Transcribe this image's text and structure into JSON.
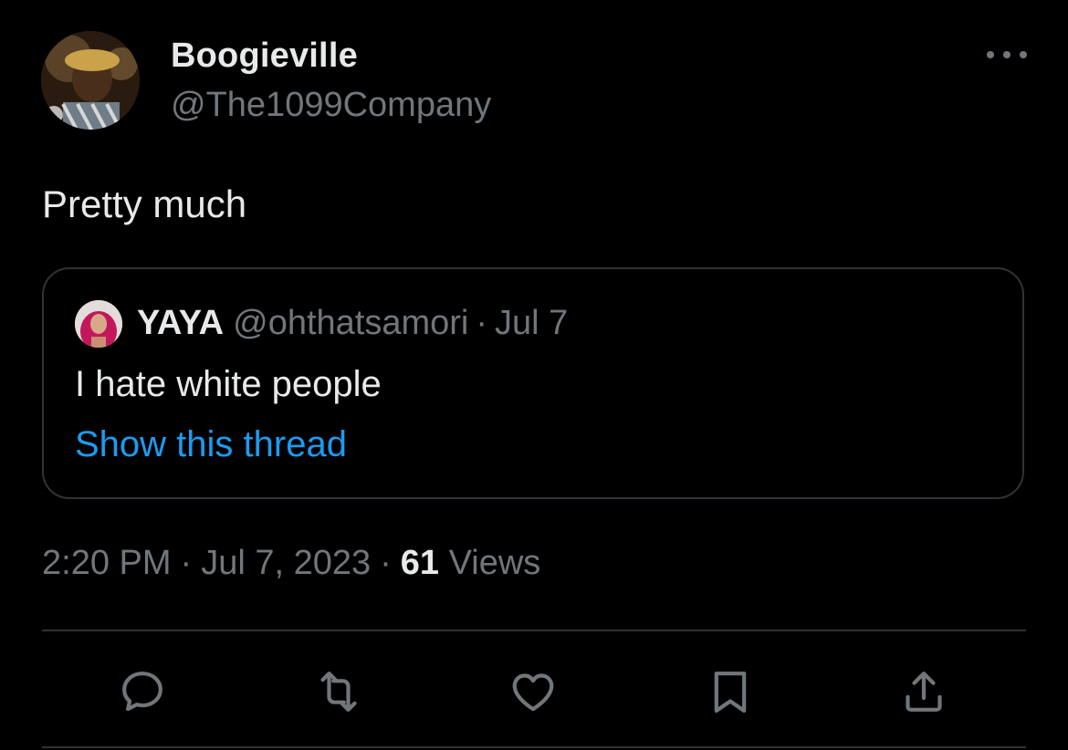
{
  "tweet": {
    "author": {
      "name": "Boogieville",
      "handle": "@The1099Company"
    },
    "text": "Pretty much",
    "quoted": {
      "name": "YAYA",
      "handle": "@ohthatsamori",
      "separator": "·",
      "date": "Jul 7",
      "text": "I hate white people",
      "show_thread": "Show this thread"
    },
    "time": "2:20 PM",
    "date": "Jul 7, 2023",
    "separator": "·",
    "views_count": "61",
    "views_label": "Views"
  },
  "actions": [
    {
      "icon": "reply-icon"
    },
    {
      "icon": "retweet-icon"
    },
    {
      "icon": "like-icon"
    },
    {
      "icon": "bookmark-icon"
    },
    {
      "icon": "share-icon"
    }
  ],
  "colors": {
    "background": "#000000",
    "primary_text": "#e7e9ea",
    "secondary_text": "#71767b",
    "link": "#1d9bf0",
    "border": "#2f3336"
  }
}
